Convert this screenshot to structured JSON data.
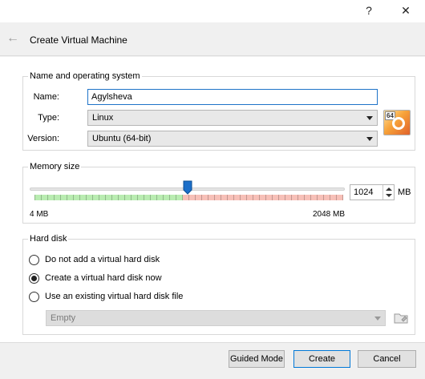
{
  "titlebar": {
    "help_glyph": "?",
    "close_glyph": "✕"
  },
  "header": {
    "title": "Create Virtual Machine",
    "back_glyph": "←"
  },
  "name_os": {
    "legend": "Name and operating system",
    "name_label": "Name:",
    "name_value": "Agylsheva",
    "type_label": "Type:",
    "type_value": "Linux",
    "version_label": "Version:",
    "version_value": "Ubuntu (64-bit)",
    "os_icon_badge": "64"
  },
  "memory": {
    "legend": "Memory size",
    "value": "1024",
    "unit": "MB",
    "min_label": "4 MB",
    "max_label": "2048 MB",
    "slider_level": 0.5
  },
  "hard_disk": {
    "legend": "Hard disk",
    "options": [
      {
        "label": "Do not add a virtual hard disk",
        "checked": false
      },
      {
        "label": "Create a virtual hard disk now",
        "checked": true
      },
      {
        "label": "Use an existing virtual hard disk file",
        "checked": false
      }
    ],
    "existing_file_value": "Empty"
  },
  "footer": {
    "guided_label": "Guided Mode",
    "create_label": "Create",
    "cancel_label": "Cancel"
  },
  "colors": {
    "accent": "#0078d7",
    "slider_green": "#b9ecb1",
    "slider_red": "#f7c0b8"
  }
}
